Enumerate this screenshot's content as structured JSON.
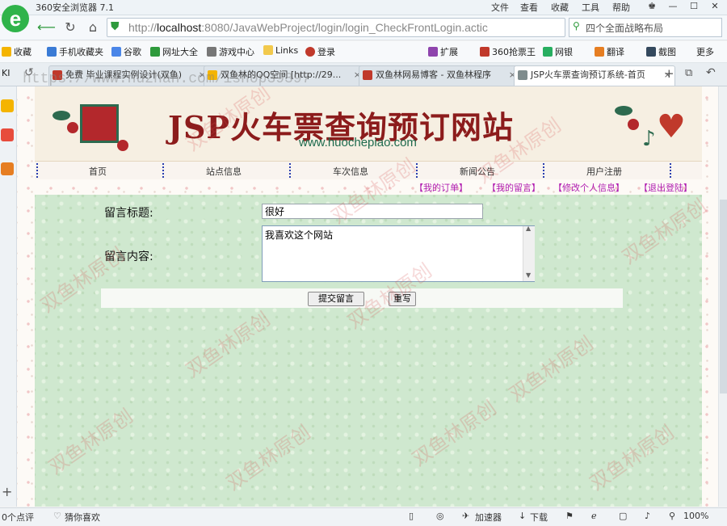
{
  "browser": {
    "title": "360安全浏览器 7.1",
    "menu": [
      "文件",
      "查看",
      "收藏",
      "工具",
      "帮助"
    ],
    "address": {
      "prefix": "http://",
      "host": "localhost",
      "rest": ":8080/JavaWebProject/login/login_CheckFrontLogin.actic"
    },
    "search_placeholder": "四个全面战略布局",
    "bookmarks": [
      "收藏",
      "手机收藏夹",
      "谷歌",
      "网址大全",
      "游戏中心",
      "Links",
      "登录",
      "扩展",
      "360抢票王",
      "网银",
      "翻译",
      "截图",
      "更多"
    ],
    "tabs": [
      {
        "label": "免费 毕业课程实例设计(双鱼)"
      },
      {
        "label": "双鱼林的QQ空间 [http://29..."
      },
      {
        "label": "双鱼林网易博客 - 双鱼林程序"
      },
      {
        "label": "JSP火车票查询预订系统-首页"
      }
    ],
    "status": {
      "comments": "0个点评",
      "guess": "猜你喜欢",
      "accelerator": "加速器",
      "download": "下载",
      "zoom": "100%"
    }
  },
  "site": {
    "banner_title": "JSP火车票查询预订网站",
    "banner_url": "www.huochepiao.com",
    "nav": [
      "首页",
      "站点信息",
      "车次信息",
      "新闻公告",
      "用户注册"
    ],
    "user_links": [
      "【我的订单】",
      "【我的留言】",
      "【修改个人信息】",
      "【退出登陆】"
    ]
  },
  "form": {
    "title_label": "留言标题:",
    "title_value": "很好",
    "content_label": "留言内容:",
    "content_value": "我喜欢这个网站",
    "submit_label": "提交留言",
    "reset_label": "重写"
  },
  "watermark": {
    "text": "双鱼林原创",
    "url": "https://www.huzhan.com/ishop39397"
  },
  "colors": {
    "banner_title": "#8c1c1c",
    "user_links": "#b01cb0",
    "content_bg": "#cfe8cf",
    "nav_separator": "#2a3fb0"
  }
}
